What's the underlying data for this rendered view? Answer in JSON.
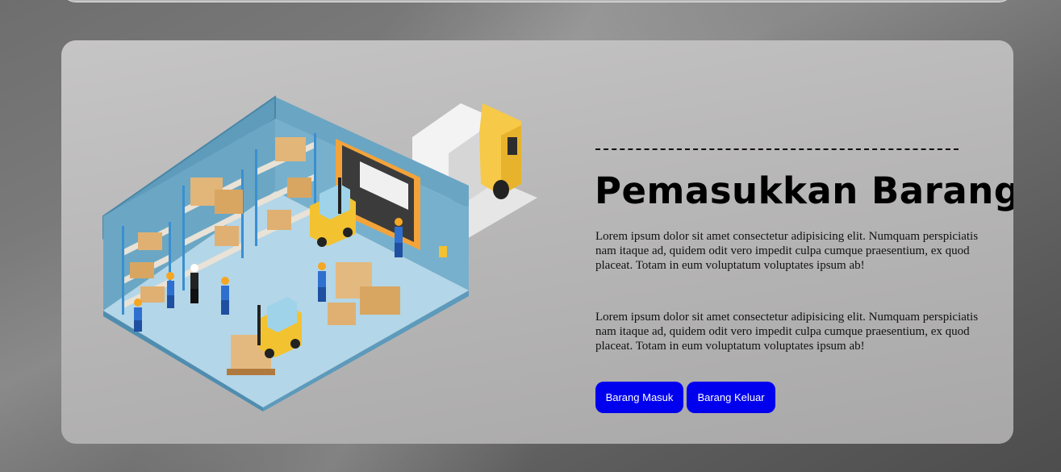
{
  "hero": {
    "title": "Pemasukkan Barang",
    "paragraphs": [
      "Lorem ipsum dolor sit amet consectetur adipisicing elit. Numquam perspiciatis nam itaque ad, quidem odit vero impedit culpa cumque praesentium, ex quod placeat. Totam in eum voluptatum voluptates ipsum ab!",
      "Lorem ipsum dolor sit amet consectetur adipisicing elit. Numquam perspiciatis nam itaque ad, quidem odit vero impedit culpa cumque praesentium, ex quod placeat. Totam in eum voluptatum voluptates ipsum ab!"
    ],
    "buttons": {
      "incoming_label": "Barang Masuk",
      "outgoing_label": "Barang Keluar"
    },
    "illustration": "isometric-warehouse-illustration"
  },
  "colors": {
    "button": "#0000ee",
    "card": "#b8b7b7",
    "warehouse_wall": "#6aa6c4",
    "warehouse_floor": "#b3d6e8",
    "truck_cab": "#f5c23a"
  }
}
